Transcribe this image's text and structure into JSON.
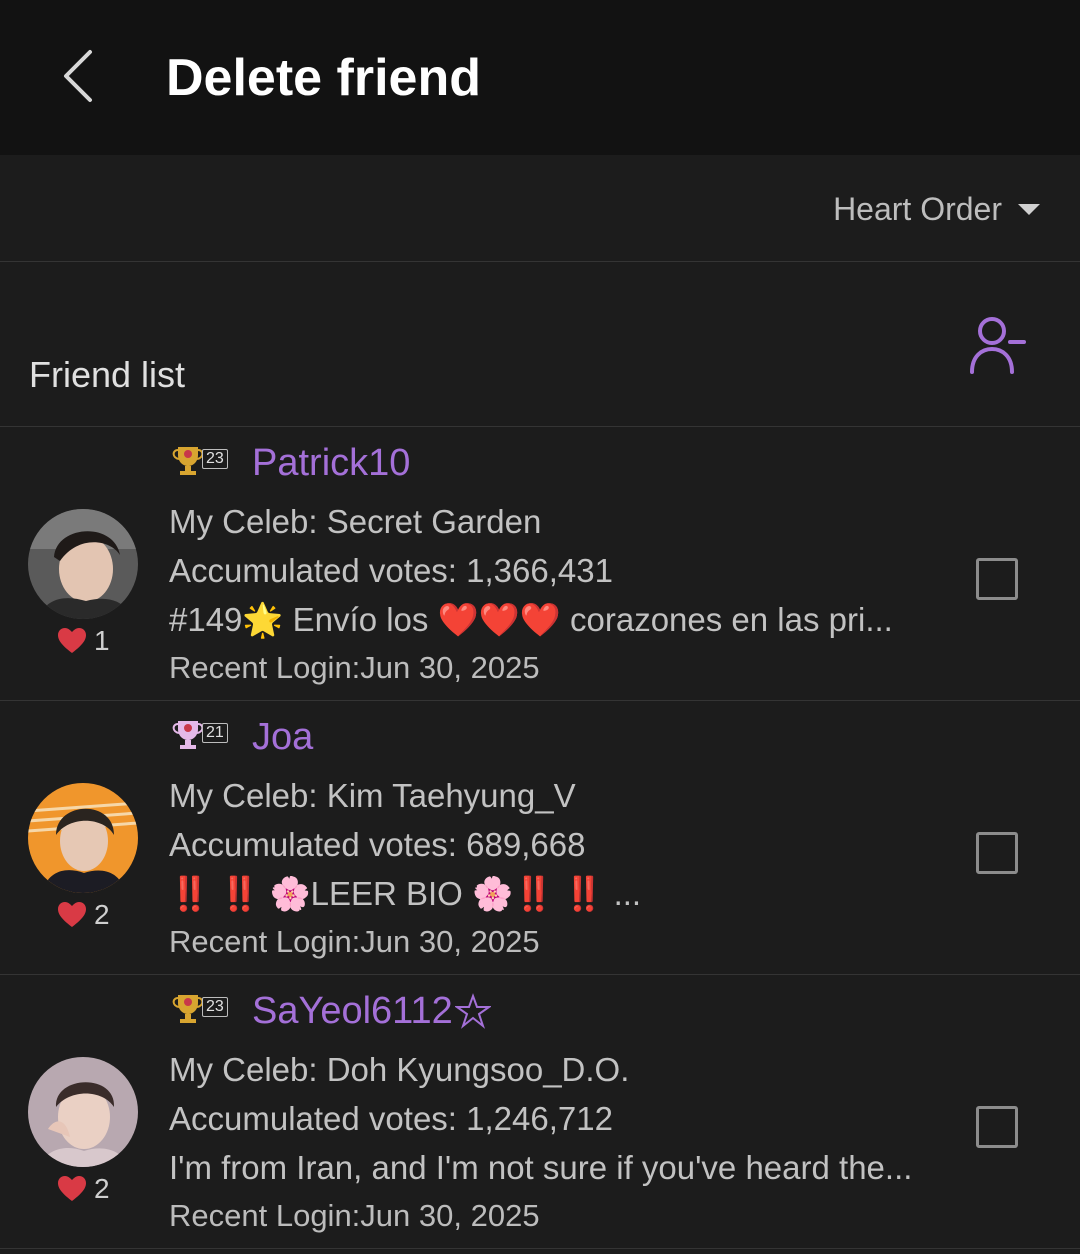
{
  "header": {
    "title": "Delete friend"
  },
  "sort": {
    "label": "Heart Order"
  },
  "list": {
    "title": "Friend list"
  },
  "friends": [
    {
      "level": "23",
      "username": "Patrick10",
      "star_suffix": false,
      "celeb": "My Celeb: Secret Garden",
      "votes": "Accumulated votes: 1,366,431",
      "bio": "#149🌟 Envío los ❤️❤️❤️ corazones en las pri...",
      "login": "Recent Login:Jun 30, 2025",
      "hearts": "1",
      "badge_color": "#d8a530",
      "avatar": "avatar-1"
    },
    {
      "level": "21",
      "username": "Joa",
      "star_suffix": false,
      "celeb": "My Celeb: Kim Taehyung_V",
      "votes": "Accumulated votes: 689,668",
      "bio": "‼️ ‼️ 🌸LEER BIO 🌸‼️ ‼️ ...",
      "login": "Recent Login:Jun 30, 2025",
      "hearts": "2",
      "badge_color": "#e4b8e8",
      "avatar": "avatar-2"
    },
    {
      "level": "23",
      "username": "SaYeol6112",
      "star_suffix": true,
      "celeb": "My Celeb: Doh Kyungsoo_D.O.",
      "votes": "Accumulated votes: 1,246,712",
      "bio": "I'm from Iran, and I'm not sure if you've heard the...",
      "login": "Recent Login:Jun 30, 2025",
      "hearts": "2",
      "badge_color": "#d8a530",
      "avatar": "avatar-3"
    }
  ],
  "colors": {
    "accent": "#a470d8",
    "heart": "#d93a45",
    "background": "#1c1c1c"
  }
}
